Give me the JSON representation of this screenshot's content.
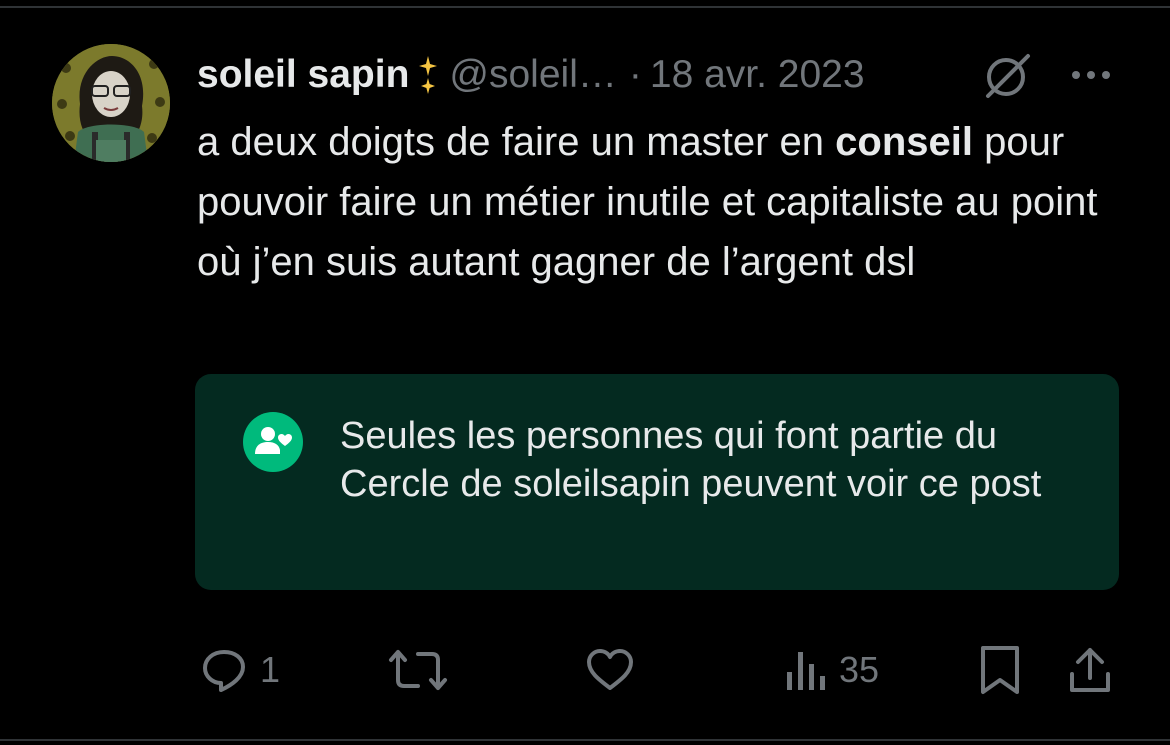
{
  "tweet": {
    "author_name": "soleil sapin",
    "handle": "@soleil…",
    "separator": "·",
    "date": "18 avr. 2023",
    "text_before_bold": "a deux doigts de faire un master en ",
    "text_bold": "conseil",
    "text_after_bold": " pour pouvoir faire un métier inutile et capitaliste au point où j’en suis autant gagner de l’argent dsl"
  },
  "circle_notice": {
    "text": "Seules les personnes qui font partie du Cercle de soleilsapin peuvent voir ce post",
    "icon": "circle-people-heart-icon"
  },
  "actions": {
    "reply_count": "1",
    "views_count": "35"
  },
  "icons": {
    "badge": "sparkle-icon",
    "grok": "grok-icon",
    "more": "more-icon",
    "reply": "reply-icon",
    "repost": "repost-icon",
    "like": "like-icon",
    "views": "views-icon",
    "bookmark": "bookmark-icon",
    "share": "share-icon"
  },
  "colors": {
    "background": "#000000",
    "text": "#e7e9ea",
    "secondary": "#71767b",
    "circle_card_bg": "#042a20",
    "circle_green": "#00ba7c",
    "badge_gold": "#f5c542"
  }
}
